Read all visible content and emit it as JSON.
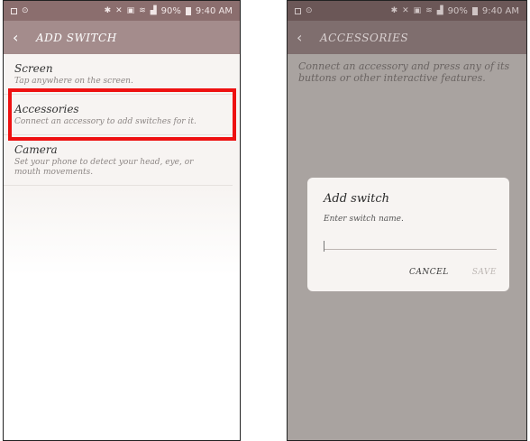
{
  "status_bar": {
    "time": "9:40 AM",
    "battery": "90%",
    "left_icons": [
      "notification-icon",
      "lock-icon"
    ],
    "right_icons": [
      "bluetooth-icon",
      "mute-icon",
      "nfc-icon",
      "wifi-icon",
      "signal-icon",
      "battery-icon"
    ]
  },
  "left_screen": {
    "title": "ADD SWITCH",
    "items": [
      {
        "title": "Screen",
        "subtitle": "Tap anywhere on the screen."
      },
      {
        "title": "Accessories",
        "subtitle": "Connect an accessory to add switches for it."
      },
      {
        "title": "Camera",
        "subtitle": "Set your phone to detect your head, eye, or mouth movements."
      }
    ],
    "highlight_color": "#ee1111"
  },
  "right_screen": {
    "title": "ACCESSORIES",
    "instructions": "Connect an accessory and press any of its buttons or other interactive features.",
    "dialog": {
      "title": "Add switch",
      "prompt": "Enter switch name.",
      "input_value": "",
      "cancel_label": "CANCEL",
      "save_label": "SAVE"
    }
  }
}
